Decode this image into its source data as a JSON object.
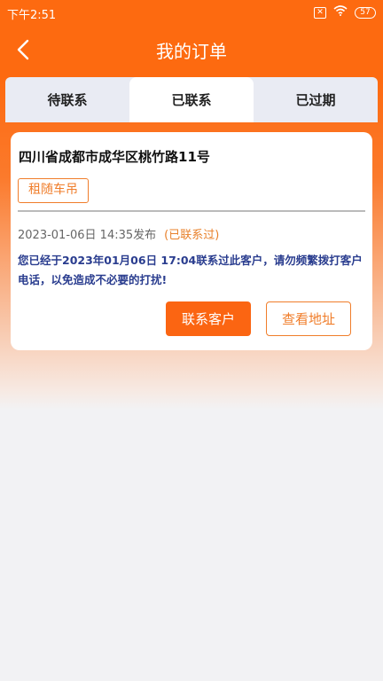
{
  "status_bar": {
    "time": "下午2:51",
    "sim_icon": "✕",
    "battery": "57"
  },
  "header": {
    "title": "我的订单",
    "back_icon": "chevron-left-icon"
  },
  "tabs": [
    {
      "label": "待联系",
      "active": false
    },
    {
      "label": "已联系",
      "active": true
    },
    {
      "label": "已过期",
      "active": false
    }
  ],
  "order": {
    "address": "四川省成都市成华区桃竹路11号",
    "tag": "租随车吊",
    "published": "2023-01-06日 14:35发布",
    "status": "(已联系过)",
    "notice": "您已经于2023年01月06日 17:04联系过此客户，请勿频繁拨打客户电话，以免造成不必要的打扰!",
    "contact_button": "联系客户",
    "address_button": "查看地址"
  },
  "colors": {
    "accent": "#fb6512",
    "notice_text": "#2a3d8f"
  }
}
